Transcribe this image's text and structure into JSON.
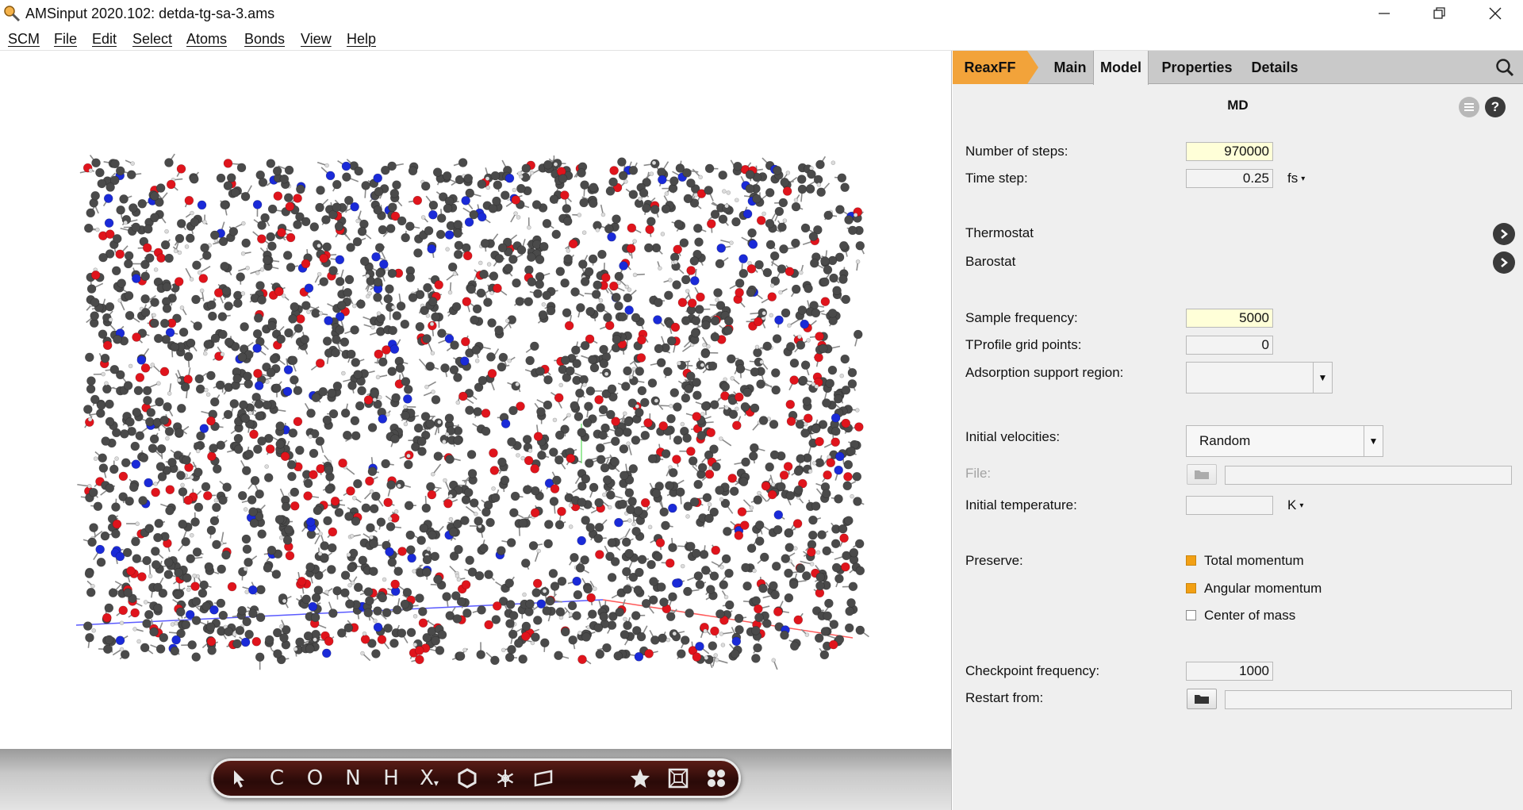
{
  "window": {
    "title": "AMSinput 2020.102: detda-tg-sa-3.ams",
    "controls": [
      "minimize-icon",
      "restore-icon",
      "close-icon"
    ]
  },
  "menu": {
    "items": [
      "SCM",
      "File",
      "Edit",
      "Select",
      "Atoms",
      "Bonds",
      "View",
      "Help"
    ]
  },
  "toolbar": {
    "tools": [
      "select-arrow-icon",
      "C",
      "O",
      "N",
      "H",
      "X",
      "ring-icon",
      "snowflake-icon",
      "plane-icon",
      "star-icon",
      "box-icon",
      "atoms-icon"
    ]
  },
  "panel": {
    "tabs": [
      "ReaxFF",
      "Main",
      "Model",
      "Properties",
      "Details"
    ],
    "active_tab": "Model",
    "section_title": "MD",
    "fields": {
      "number_of_steps": {
        "label": "Number of steps:",
        "value": "970000"
      },
      "time_step": {
        "label": "Time step:",
        "value": "0.25",
        "unit": "fs"
      },
      "thermostat": {
        "label": "Thermostat"
      },
      "barostat": {
        "label": "Barostat"
      },
      "sample_frequency": {
        "label": "Sample frequency:",
        "value": "5000"
      },
      "tprofile_grid_points": {
        "label": "TProfile grid points:",
        "value": "0"
      },
      "adsorption_support_region": {
        "label": "Adsorption support region:",
        "value": ""
      },
      "initial_velocities": {
        "label": "Initial velocities:",
        "value": "Random"
      },
      "file": {
        "label": "File:",
        "value": ""
      },
      "initial_temperature": {
        "label": "Initial temperature:",
        "value": "",
        "unit": "K"
      },
      "preserve": {
        "label": "Preserve:",
        "options": [
          {
            "label": "Total momentum",
            "checked": true
          },
          {
            "label": "Angular momentum",
            "checked": true
          },
          {
            "label": "Center of mass",
            "checked": false
          }
        ]
      },
      "checkpoint_frequency": {
        "label": "Checkpoint frequency:",
        "value": "1000"
      },
      "restart_from": {
        "label": "Restart from:",
        "value": ""
      }
    }
  },
  "colors": {
    "reaxff_tab": "#f2a33a",
    "input_highlight": "#ffffd8",
    "checkbox_on": "#f2a014",
    "carbon": "#4a4a4a",
    "oxygen": "#e0141c",
    "nitrogen": "#1a2ad8",
    "hydrogen": "#dcdcdc"
  }
}
